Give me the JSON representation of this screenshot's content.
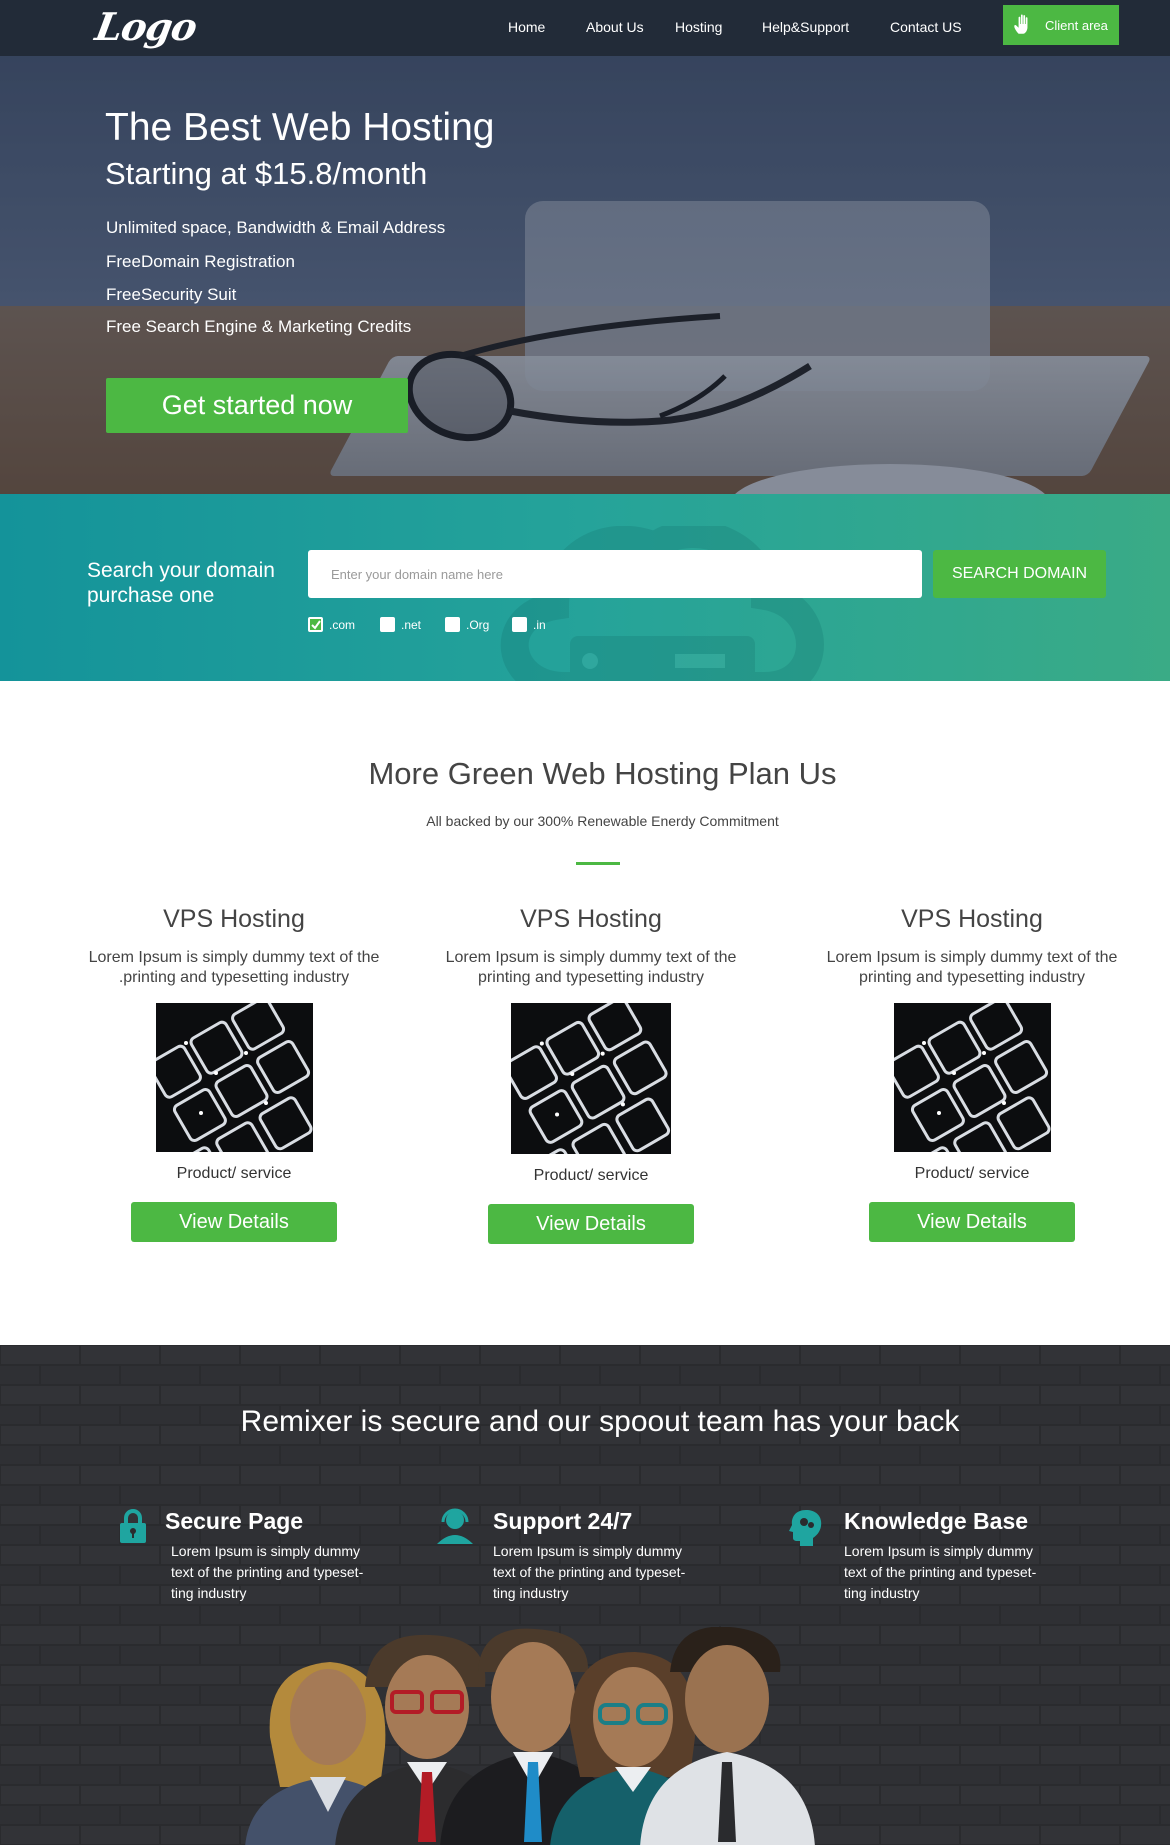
{
  "nav": {
    "logo": "Logo",
    "links": [
      "Home",
      "About Us",
      "Hosting",
      "Help&Support",
      "Contact US"
    ],
    "client_label": "Client area"
  },
  "hero": {
    "title": "The Best Web Hosting",
    "subtitle": "Starting at $15.8/month",
    "features": [
      "Unlimited space,  Bandwidth & Email Address",
      "FreeDomain Registration",
      "FreeSecurity Suit",
      "Free Search Engine & Marketing Credits"
    ],
    "cta": "Get started now"
  },
  "domain": {
    "label": "Search your domain purchase one",
    "placeholder": "Enter your domain name here",
    "button": "SEARCH DOMAIN",
    "tlds": [
      {
        "label": ".com",
        "checked": true
      },
      {
        "label": ".net",
        "checked": false
      },
      {
        "label": ".Org",
        "checked": false
      },
      {
        "label": ".in",
        "checked": false
      }
    ]
  },
  "plans": {
    "title": "More Green Web Hosting Plan Us",
    "subtitle": "All backed by our 300% Renewable Enerdy Commitment",
    "items": [
      {
        "title": "VPS Hosting",
        "desc": "Lorem Ipsum is simply dummy text of the .printing and typesetting industry",
        "product": "Product/ service",
        "button": "View Details"
      },
      {
        "title": "VPS Hosting",
        "desc": "Lorem Ipsum is simply dummy text of the printing and typesetting industry",
        "product": "Product/ service",
        "button": "View Details"
      },
      {
        "title": "VPS Hosting",
        "desc": "Lorem Ipsum is simply dummy text of the printing and typesetting industry",
        "product": "Product/ service",
        "button": "View Details"
      }
    ]
  },
  "secure": {
    "title": "Remixer is secure and our spoout team has your back",
    "features": [
      {
        "title": "Secure Page",
        "icon": "lock-icon",
        "desc": "Lorem Ipsum is simply dummy text of the printing and typeset-ting industry"
      },
      {
        "title": "Support 24/7",
        "icon": "support-agent-icon",
        "desc": "Lorem Ipsum is simply dummy text of the printing and typeset-ting industry"
      },
      {
        "title": "Knowledge Base",
        "icon": "brain-head-icon",
        "desc": "Lorem Ipsum is simply dummy text of the printing and typeset-ting industry"
      }
    ]
  },
  "colors": {
    "nav_bg": "#222b38",
    "accent_green": "#4cb843",
    "teal": "#1b9a9a",
    "dark_section": "#2a2b2e"
  }
}
